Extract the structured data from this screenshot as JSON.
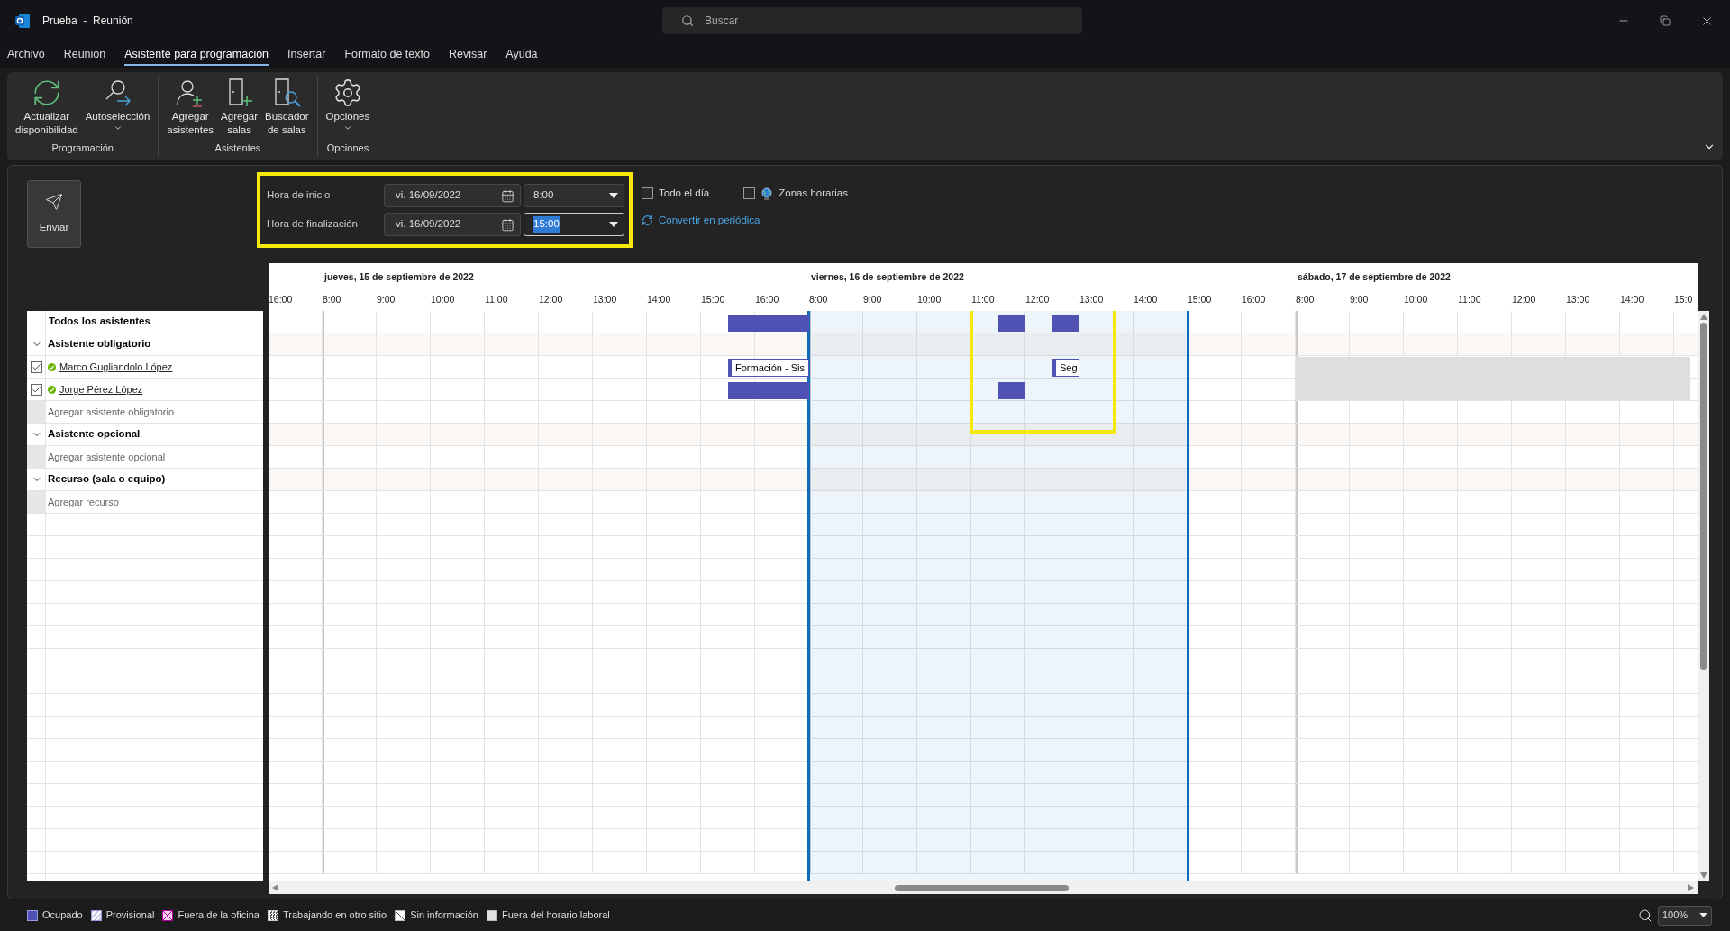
{
  "window": {
    "title": "Prueba  -  Reunión",
    "search_placeholder": "Buscar"
  },
  "menu_tabs": [
    {
      "label": "Archivo",
      "selected": false
    },
    {
      "label": "Reunión",
      "selected": false
    },
    {
      "label": "Asistente para programación",
      "selected": true
    },
    {
      "label": "Insertar",
      "selected": false
    },
    {
      "label": "Formato de texto",
      "selected": false
    },
    {
      "label": "Revisar",
      "selected": false
    },
    {
      "label": "Ayuda",
      "selected": false
    }
  ],
  "ribbon_groups": [
    {
      "label": "Programación",
      "buttons": [
        {
          "kind": "refresh",
          "lines": [
            "Actualizar",
            "disponibilidad"
          ],
          "dropdown": false
        },
        {
          "kind": "autoselect",
          "lines": [
            "Autoselección"
          ],
          "dropdown": true
        }
      ]
    },
    {
      "label": "Asistentes",
      "buttons": [
        {
          "kind": "add-person",
          "lines": [
            "Agregar",
            "asistentes"
          ],
          "dropdown": false
        },
        {
          "kind": "add-room",
          "lines": [
            "Agregar",
            "salas"
          ],
          "dropdown": false
        },
        {
          "kind": "find-room",
          "lines": [
            "Buscador",
            "de salas"
          ],
          "dropdown": false
        }
      ]
    },
    {
      "label": "Opciones",
      "buttons": [
        {
          "kind": "gear",
          "lines": [
            "Opciones"
          ],
          "dropdown": true
        }
      ]
    }
  ],
  "send_button": {
    "label": "Enviar"
  },
  "time_rows": [
    {
      "label": "Hora de inicio",
      "date": "vi. 16/09/2022",
      "time": "8:00",
      "focused": false
    },
    {
      "label": "Hora de finalización",
      "date": "vi. 16/09/2022",
      "time": "15:00",
      "focused": true
    }
  ],
  "options": [
    {
      "kind": "plain",
      "label": "Todo el día",
      "checked": false
    },
    {
      "kind": "timezone",
      "label": "Zonas horarias",
      "checked": false
    }
  ],
  "recurrence_link": "Convertir en periódica",
  "schedule": {
    "days": [
      {
        "hours": [
          "16:00"
        ]
      },
      {
        "label": "jueves, 15 de septiembre de 2022",
        "hours": [
          "8:00",
          "9:00",
          "10:00",
          "11:00",
          "12:00",
          "13:00",
          "14:00",
          "15:00",
          "16:00"
        ]
      },
      {
        "label": "viernes, 16 de septiembre de 2022",
        "hours": [
          "8:00",
          "9:00",
          "10:00",
          "11:00",
          "12:00",
          "13:00",
          "14:00",
          "15:00",
          "16:00"
        ]
      },
      {
        "label": "sábado, 17 de septiembre de 2022",
        "hours": [
          "8:00",
          "9:00",
          "10:00",
          "11:00",
          "12:00",
          "13:00",
          "14:00",
          "15:0"
        ]
      }
    ],
    "rows": [
      {
        "kind": "all",
        "label": "Todos los asistentes",
        "events": [
          {
            "kind": "busy"
          },
          {
            "kind": "busy"
          },
          {
            "kind": "busy"
          }
        ]
      },
      {
        "kind": "group",
        "label": "Asistente obligatorio",
        "expanded": true
      },
      {
        "kind": "attendee",
        "label": "Marco Gugliandolo López",
        "checked": true,
        "events": [
          {
            "kind": "labeled",
            "label": "Formación - Sis"
          },
          {
            "kind": "labeled",
            "label": "Seg"
          },
          {
            "kind": "offhours"
          }
        ]
      },
      {
        "kind": "attendee",
        "label": "Jorge Pérez López",
        "checked": true,
        "events": [
          {
            "kind": "busy"
          },
          {
            "kind": "busy"
          },
          {
            "kind": "offhours"
          }
        ]
      },
      {
        "kind": "add",
        "label": "Agregar asistente obligatorio"
      },
      {
        "kind": "group",
        "label": "Asistente opcional",
        "expanded": true
      },
      {
        "kind": "add",
        "label": "Agregar asistente opcional"
      },
      {
        "kind": "group",
        "label": "Recurso (sala o equipo)",
        "expanded": true
      },
      {
        "kind": "add",
        "label": "Agregar recurso"
      }
    ]
  },
  "legend": [
    {
      "kind": "busy",
      "label": "Ocupado"
    },
    {
      "kind": "tentative",
      "label": "Provisional"
    },
    {
      "kind": "oof",
      "label": "Fuera de la oficina"
    },
    {
      "kind": "elsewhere",
      "label": "Trabajando en otro sitio"
    },
    {
      "kind": "noinfo",
      "label": "Sin información"
    },
    {
      "kind": "offhours",
      "label": "Fuera del horario laboral"
    }
  ],
  "zoom": {
    "value": "100%"
  }
}
